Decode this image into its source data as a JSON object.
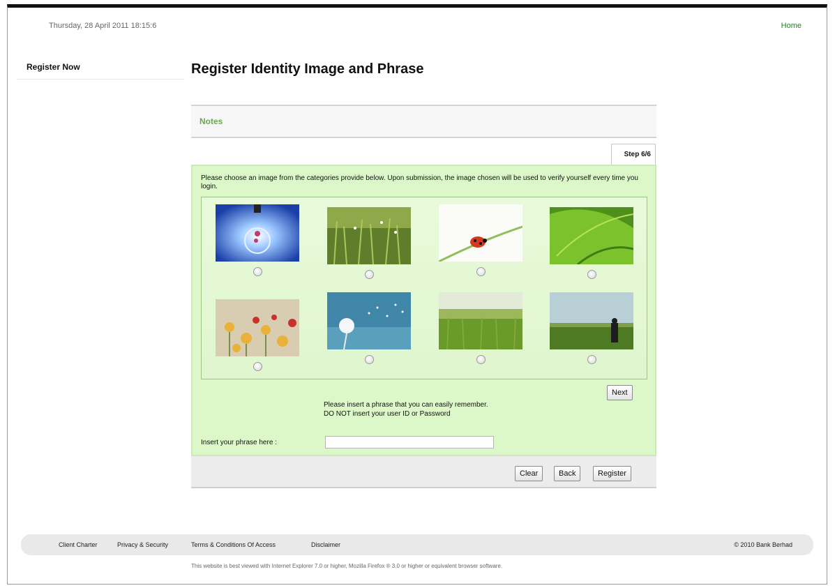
{
  "header": {
    "datetime": "Thursday, 28 April 2011 18:15:6",
    "home_label": "Home"
  },
  "sidebar": {
    "items": [
      {
        "label": "Register Now"
      }
    ]
  },
  "main": {
    "title": "Register Identity Image and Phrase",
    "notes_label": "Notes",
    "step": "Step 6/6",
    "instructions": "Please choose an image from the categories provide below. Upon submission, the image chosen will be used to verify yourself every time you login.",
    "images": [
      {
        "name": "light-bulb-image",
        "selected": false
      },
      {
        "name": "grass-dew-image",
        "selected": false
      },
      {
        "name": "ladybug-image",
        "selected": false
      },
      {
        "name": "green-leaf-image",
        "selected": false
      },
      {
        "name": "flowers-image",
        "selected": false
      },
      {
        "name": "dandelion-image",
        "selected": false
      },
      {
        "name": "wheat-field-image",
        "selected": false
      },
      {
        "name": "person-in-field-image",
        "selected": false
      }
    ],
    "next_label": "Next",
    "phrase_note_line1": "Please insert a phrase that you can easily remember.",
    "phrase_note_line2": "DO NOT insert your user ID or Password",
    "phrase_label": "Insert your phrase here :",
    "phrase_value": "",
    "clear_label": "Clear",
    "back_label": "Back",
    "register_label": "Register"
  },
  "footer": {
    "links": [
      "Client Charter",
      "Privacy & Security",
      "Terms & Conditions Of Access",
      "Disclaimer"
    ],
    "copyright": "© 2010 Bank Berhad",
    "browser_note": "This website is best viewed with Internet Explorer 7.0 or higher, Mozilla Firefox ® 3.0 or higher or equivalent browser software."
  },
  "colors": {
    "accent_green": "#6aa84f",
    "panel_bg": "#dcf8c8",
    "link_green": "#2a7a2a"
  }
}
